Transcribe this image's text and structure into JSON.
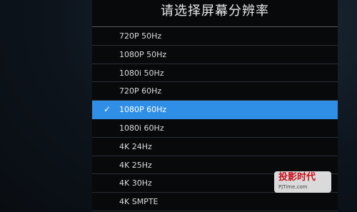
{
  "dialog": {
    "title": "请选择屏幕分辨率"
  },
  "options": [
    {
      "label": "720P 50Hz",
      "selected": false
    },
    {
      "label": "1080P 50Hz",
      "selected": false
    },
    {
      "label": "1080i 50Hz",
      "selected": false
    },
    {
      "label": "720P 60Hz",
      "selected": false
    },
    {
      "label": "1080P 60Hz",
      "selected": true
    },
    {
      "label": "1080i 60Hz",
      "selected": false
    },
    {
      "label": "4K 24Hz",
      "selected": false
    },
    {
      "label": "4K 25Hz",
      "selected": false
    },
    {
      "label": "4K 30Hz",
      "selected": false
    },
    {
      "label": "4K SMPTE",
      "selected": false
    }
  ],
  "selected_check_icon": "✓",
  "colors": {
    "highlight": "#2f8ee6",
    "panel_bg": "#07090b"
  },
  "watermark": {
    "brand": "投影时代",
    "url": "PjTime.com"
  }
}
